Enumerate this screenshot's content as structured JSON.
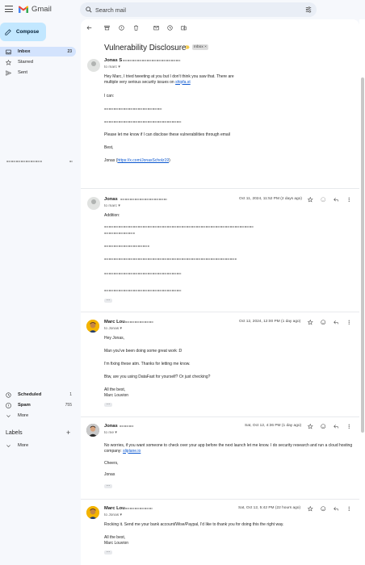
{
  "header": {
    "app_name": "Gmail",
    "search_placeholder": "Search mail"
  },
  "sidebar": {
    "compose_label": "Compose",
    "items": [
      {
        "label": "Inbox",
        "count": "23"
      },
      {
        "label": "Starred",
        "count": ""
      },
      {
        "label": "Sent",
        "count": ""
      },
      {
        "label": "Scheduled",
        "count": "1"
      },
      {
        "label": "Spam",
        "count": "755"
      },
      {
        "label": "More",
        "count": ""
      }
    ],
    "labels_title": "Labels",
    "labels_more": "More"
  },
  "thread": {
    "subject": "Vulnerability Disclosure",
    "inbox_chip": "Inbox",
    "messages": [
      {
        "sender": "Jonas S",
        "to": "to marc",
        "timestamp": "",
        "body": [
          "Hey Marc, I tried tweeting at you but I don't think you saw that. There are multiple very serious security issues on ",
          "I can:",
          "Please let me know if I can disclose these vulnerabilities through email",
          "Best,",
          "Jonas ("
        ],
        "link1": "shipfa.st",
        "link2": "https://x.com/JonasScholz19",
        "close_paren": ")"
      },
      {
        "sender": "Jonas",
        "to": "to marc",
        "timestamp": "Oct 11, 2024, 11:52 PM (2 days ago)",
        "body": [
          "Addition:"
        ]
      },
      {
        "sender": "Marc Lou",
        "to": "to Jonas",
        "timestamp": "Oct 12, 2024, 12:00 PM (1 day ago)",
        "body": [
          "Hey Jonas,",
          "Man you've been doing some great work :D",
          "I'm fixing these atm. Thanks for letting me know.",
          "Btw, are you using DataFast for yourself? Or just checking?",
          "All the best,",
          "Marc Louvion"
        ]
      },
      {
        "sender": "Jonas",
        "to": "to me",
        "timestamp": "Sat, Oct 12, 4:36 PM (1 day ago)",
        "body": [
          "No worries, if you want someone to check over your app before the next launch let me know. I do security research and run a cloud hosting company: ",
          "Cheers,",
          "Jonas"
        ],
        "link1": "sliplane.io"
      },
      {
        "sender": "Marc Lou",
        "to": "to Jonas",
        "timestamp": "Sat, Oct 12, 5:42 PM (22 hours ago)",
        "body": [
          "Rocking it. Send me your bank account/Wise/Paypal, I'd like to thank you for doing this the right way.",
          "All the best,",
          "Marc Louvion"
        ]
      }
    ]
  }
}
